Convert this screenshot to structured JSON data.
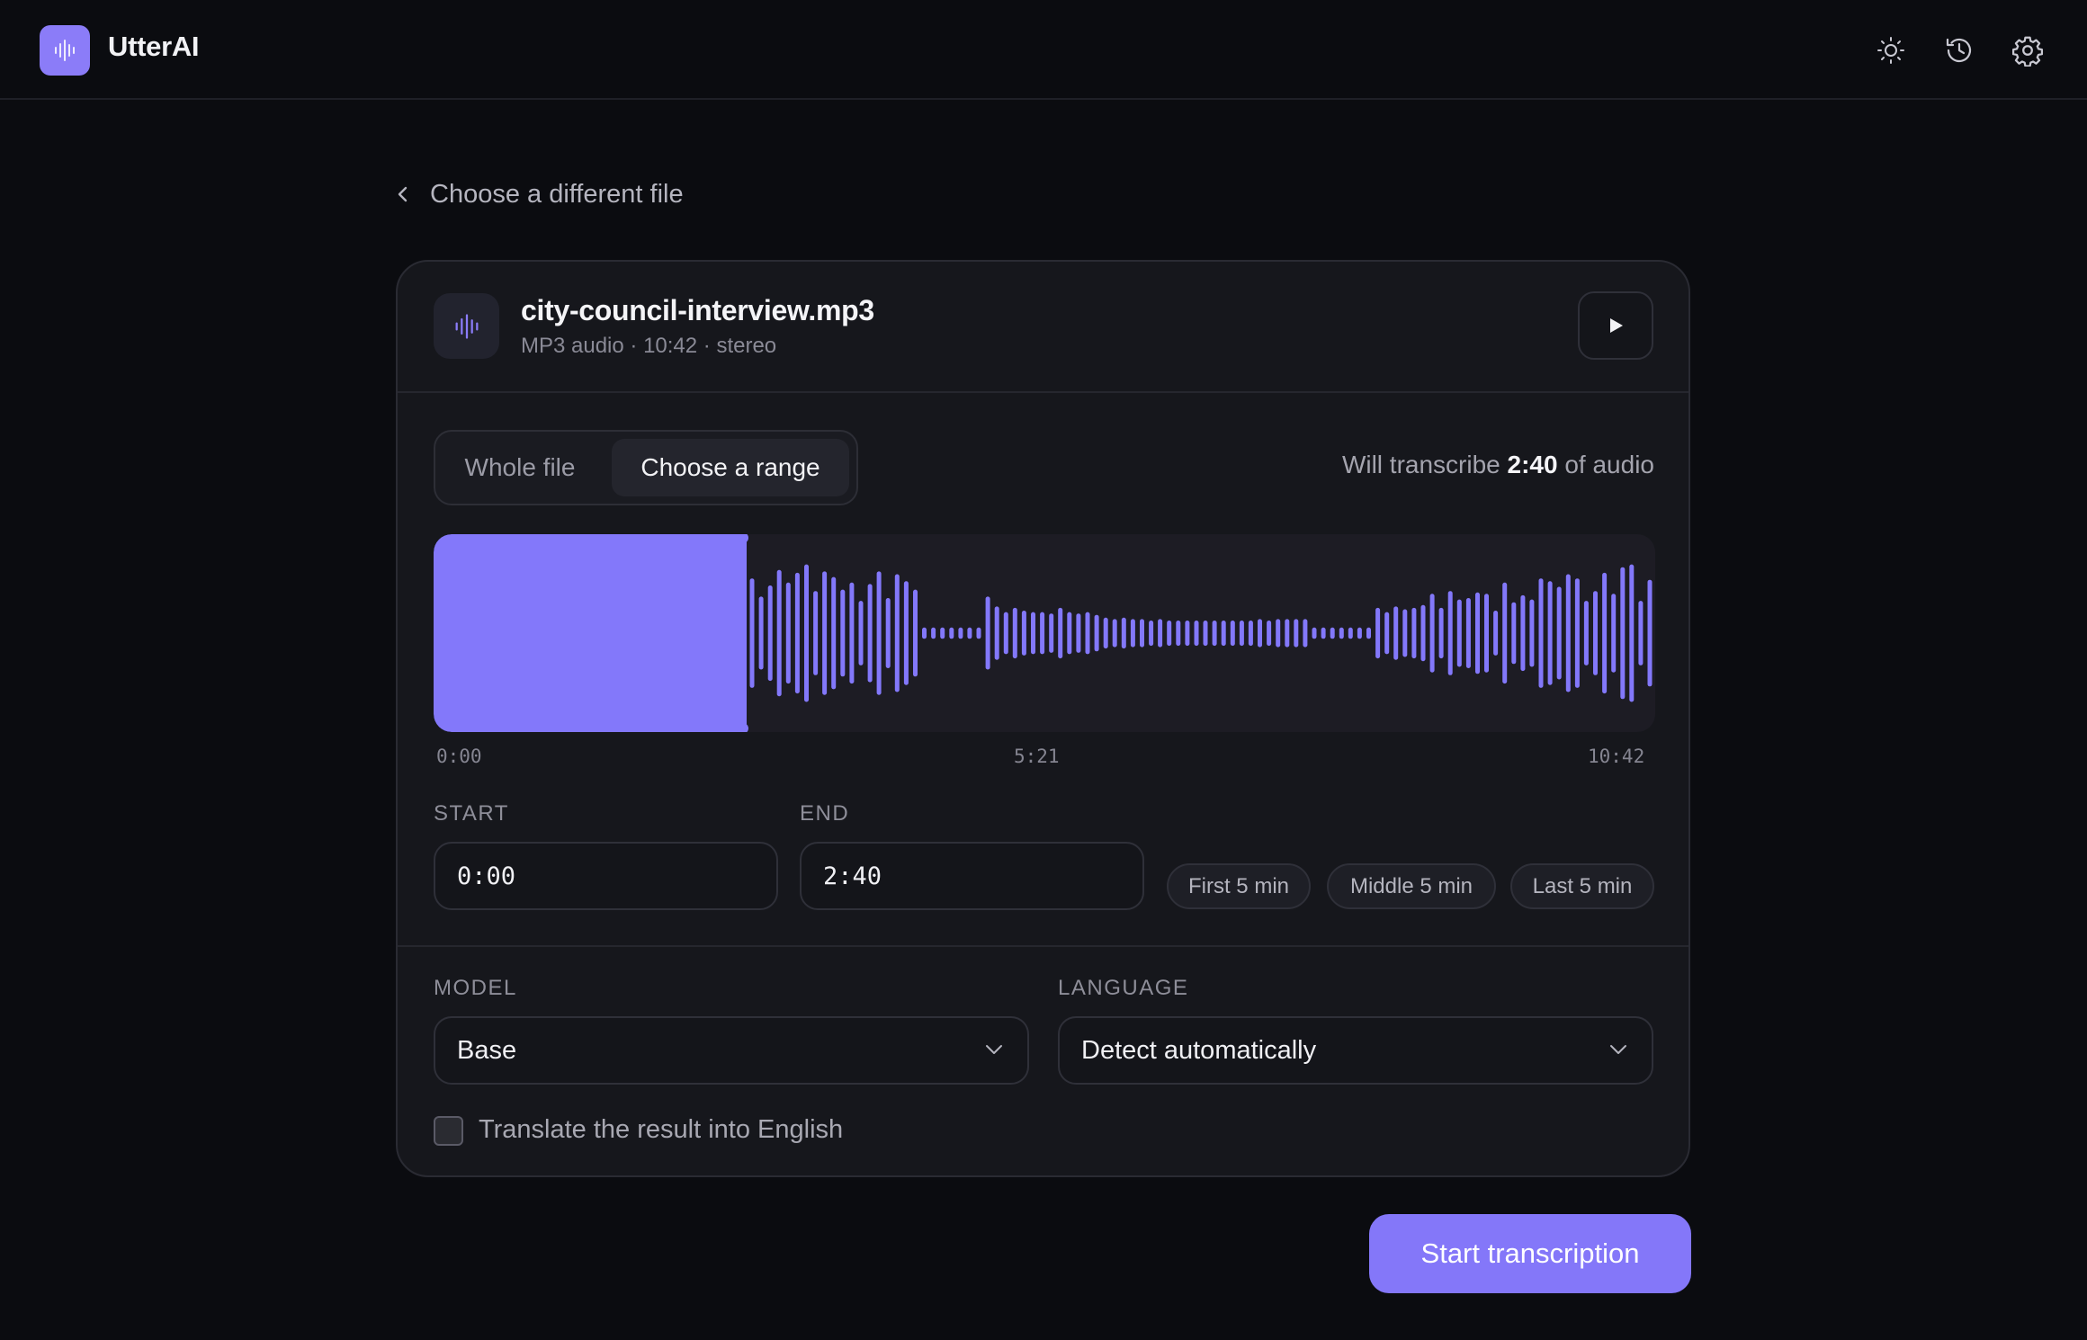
{
  "app": {
    "name": "UtterAI",
    "accent": "#8378fa"
  },
  "header": {
    "icons": [
      "sun-icon",
      "history-icon",
      "gear-icon"
    ]
  },
  "back": {
    "label": "Choose a different file"
  },
  "file": {
    "name": "city-council-interview.mp3",
    "meta": "MP3 audio · 10:42 · stereo"
  },
  "range_mode": {
    "options": [
      "Whole file",
      "Choose a range"
    ],
    "selected": "Choose a range"
  },
  "summary": {
    "prefix": "Will transcribe ",
    "duration": "2:40",
    "suffix": " of audio"
  },
  "waveform": {
    "ticks": [
      "0:00",
      "5:21",
      "10:42"
    ],
    "selection_start_fraction": 0,
    "selection_end_fraction": 0.2492,
    "amplitudes": [
      0.78,
      0.52,
      0.68,
      0.9,
      0.72,
      0.86,
      0.98,
      0.6,
      0.88,
      0.8,
      0.62,
      0.72,
      0.46,
      0.7,
      0.88,
      0.5,
      0.84,
      0.74,
      0.62,
      0.08,
      0.08,
      0.08,
      0.08,
      0.08,
      0.08,
      0.08,
      0.52,
      0.38,
      0.3,
      0.36,
      0.32,
      0.3,
      0.3,
      0.28,
      0.36,
      0.3,
      0.28,
      0.3,
      0.26,
      0.22,
      0.2,
      0.22,
      0.2,
      0.2,
      0.18,
      0.2,
      0.18,
      0.18,
      0.18,
      0.18,
      0.18,
      0.18,
      0.18,
      0.18,
      0.18,
      0.18,
      0.2,
      0.18,
      0.2,
      0.2,
      0.2,
      0.2,
      0.08,
      0.08,
      0.08,
      0.08,
      0.08,
      0.08,
      0.08,
      0.36,
      0.3,
      0.38,
      0.34,
      0.36,
      0.4,
      0.56,
      0.36,
      0.6,
      0.48,
      0.5,
      0.58,
      0.56,
      0.32,
      0.72,
      0.44,
      0.54,
      0.48,
      0.78,
      0.74,
      0.66,
      0.84,
      0.78,
      0.46,
      0.6,
      0.86,
      0.56,
      0.94,
      0.98,
      0.46,
      0.76
    ]
  },
  "start": {
    "label": "START",
    "value": "0:00"
  },
  "end": {
    "label": "END",
    "value": "2:40"
  },
  "presets": [
    "First 5 min",
    "Middle 5 min",
    "Last 5 min"
  ],
  "model": {
    "label": "MODEL",
    "value": "Base"
  },
  "language": {
    "label": "LANGUAGE",
    "value": "Detect automatically"
  },
  "translate": {
    "label": "Translate the result into English",
    "checked": false
  },
  "submit": {
    "label": "Start transcription"
  }
}
